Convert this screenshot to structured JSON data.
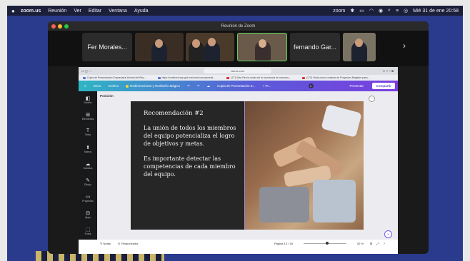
{
  "menubar": {
    "apple": "",
    "app": "zoom.us",
    "items": [
      "Reunión",
      "Ver",
      "Editar",
      "Ventana",
      "Ayuda"
    ],
    "zoom_status": "zoom",
    "datetime": "Mié 31 de ene 20:58"
  },
  "zoom_window": {
    "title": "Reunión de Zoom",
    "participants": [
      {
        "name": "Fer Morales..."
      },
      {
        "name": ""
      },
      {
        "name": ""
      },
      {
        "name": ""
      },
      {
        "name": "fernando Gar..."
      },
      {
        "name": ""
      }
    ],
    "next": "›"
  },
  "browser": {
    "url": "canva.com",
    "tabs": [
      "Copia de Presentación Empresarial Animal del Rep...",
      "https://cmsfront.sep.gob.mx/core/cursos/portal...",
      "(171) Bac Res la rueda de la ocurrencia de vacunas...",
      "(172) Visita como construir de Proyectos Magister paso..."
    ]
  },
  "canva": {
    "menu": [
      "Inicio",
      "Archivo",
      "Redimensionar y Rediseño Mágico",
      "Copia de Presentación E...",
      "+ Pr..."
    ],
    "present": "Presentar",
    "share": "Compartir",
    "avatar": "L",
    "position_label": "Posición",
    "sidenav": [
      {
        "icon": "◧",
        "label": "Diseño"
      },
      {
        "icon": "⊞",
        "label": "Elementos"
      },
      {
        "icon": "T",
        "label": "Texto"
      },
      {
        "icon": "⬆",
        "label": "Marca"
      },
      {
        "icon": "☁",
        "label": "Subidos"
      },
      {
        "icon": "✎",
        "label": "Dibujo"
      },
      {
        "icon": "▭",
        "label": "Proyectos"
      },
      {
        "icon": "⊟",
        "label": "Apps"
      },
      {
        "icon": "⬚",
        "label": "Fotos"
      }
    ],
    "slide": {
      "heading": "Recomendación #2",
      "p1": "La unión de todos los miembros del equipo potencializa el logro de objetivos y metas.",
      "p2": "Es importante detectar las competencias de cada miembro del equipo."
    },
    "footer": {
      "notes": "Notas",
      "timer": "Temporizador",
      "page": "Página 13 / 18",
      "zoom": "52 %",
      "zoom_level": 0.52
    }
  }
}
